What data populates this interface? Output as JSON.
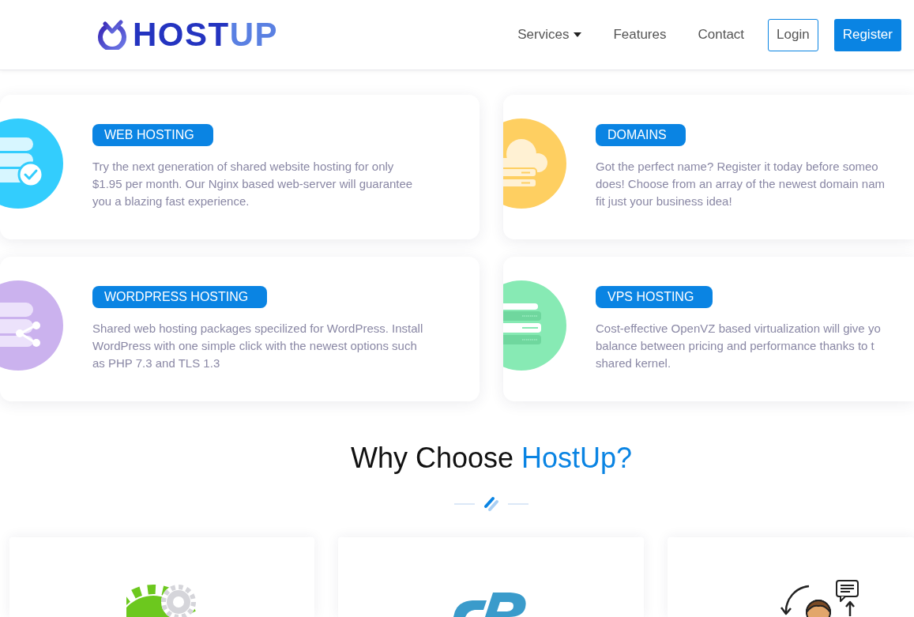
{
  "header": {
    "logo": {
      "primary": "HOST",
      "accent": "UP"
    },
    "nav": [
      {
        "label": "Services",
        "dropdown": true
      },
      {
        "label": "Features",
        "dropdown": false
      },
      {
        "label": "Contact",
        "dropdown": false
      }
    ],
    "buttons": [
      {
        "label": "Login",
        "kind": "outline"
      },
      {
        "label": "Register",
        "kind": "filled"
      }
    ]
  },
  "services": [
    {
      "kind": "web",
      "badge": "WEB HOSTING",
      "description": [
        "Try the next generation of shared website hosting for only",
        "$1.95 per month. Our Nginx based web-server will guarantee",
        "you a blazing fast experience."
      ]
    },
    {
      "kind": "domain",
      "badge": "DOMAINS",
      "description": [
        "Got the perfect name? Register it today before someo",
        "does! Choose from an array of the newest domain nam",
        "fit just your business idea!"
      ]
    },
    {
      "kind": "wordpress",
      "badge": "WORDPRESS HOSTING",
      "description": [
        "Shared web hosting packages specilized for WordPress. Install",
        "WordPress with one simple click with the newest options such",
        "as PHP 7.3 and TLS 1.3"
      ]
    },
    {
      "kind": "vps",
      "badge": "VPS HOSTING",
      "description": [
        "Cost-effective OpenVZ based virtualization will give yo",
        "balance between pricing and performance thanks to t",
        "shared kernel."
      ]
    }
  ],
  "why_choose": {
    "title": "Why Choose",
    "highlight": "HostUp?"
  },
  "features": [
    {
      "kind": "gears"
    },
    {
      "kind": "panel"
    },
    {
      "kind": "support"
    }
  ]
}
